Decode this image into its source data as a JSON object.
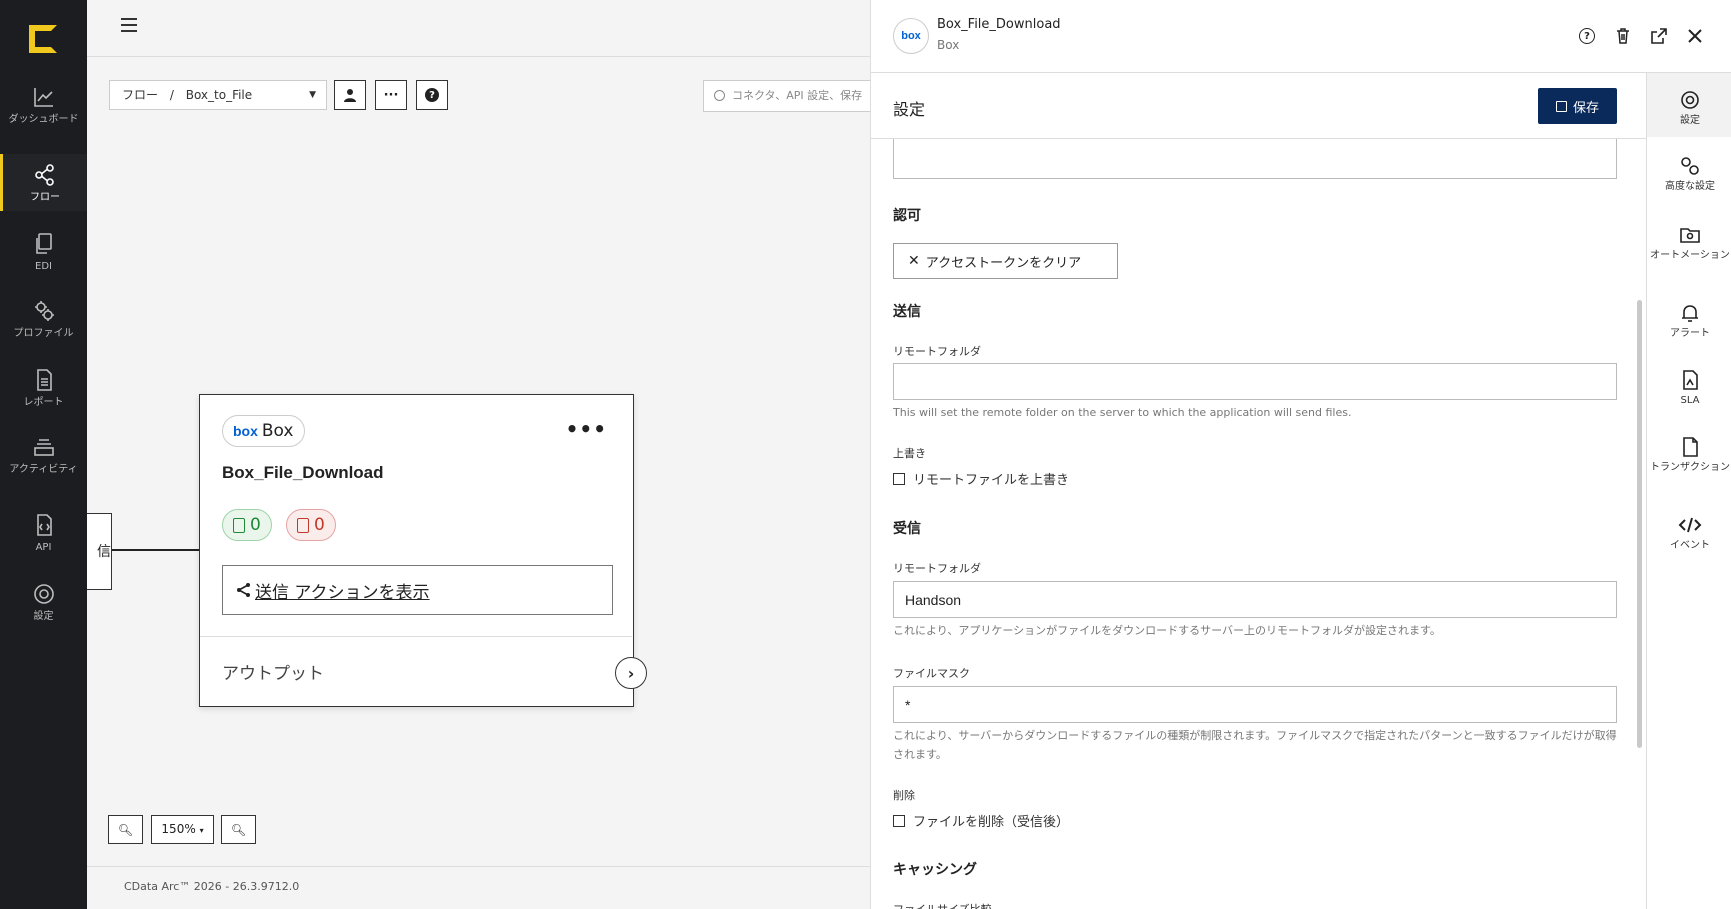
{
  "nav": {
    "items": [
      {
        "label": "ダッシュボード",
        "icon": "chart-line-icon"
      },
      {
        "label": "フロー",
        "icon": "share-nodes-icon"
      },
      {
        "label": "EDI",
        "icon": "documents-icon"
      },
      {
        "label": "プロファイル",
        "icon": "gears-icon"
      },
      {
        "label": "レポート",
        "icon": "report-icon"
      },
      {
        "label": "アクティビティ",
        "icon": "layers-icon"
      },
      {
        "label": "API",
        "icon": "api-file-icon"
      },
      {
        "label": "設定",
        "icon": "gear-icon"
      }
    ],
    "accent": "#f0c81e"
  },
  "toolbar": {
    "breadcrumb_root": "フロー",
    "breadcrumb_sep": "/",
    "breadcrumb_current": "Box_to_File",
    "search_placeholder": "コネクタ、API 設定、保存"
  },
  "left_node": {
    "text": "信"
  },
  "card": {
    "pill_logo": "box",
    "pill_label": "Box",
    "title": "Box_File_Download",
    "success_count": "0",
    "error_count": "0",
    "action_label": "送信 アクションを表示",
    "output_label": "アウトプット"
  },
  "zoom": {
    "level": "150%"
  },
  "footer": {
    "text": "CData Arc™ 2026 - 26.3.9712.0"
  },
  "panel": {
    "avatar": "box",
    "title": "Box_File_Download",
    "subtitle": "Box",
    "settings_title": "設定",
    "save_label": "保存",
    "save_color": "#0a2a5c"
  },
  "form": {
    "auth_section": "認可",
    "clear_token": "アクセストークンをクリア",
    "send_section": "送信",
    "send_remote_label": "リモートフォルダ",
    "send_remote_value": "",
    "send_remote_help": "This will set the remote folder on the server to which the application will send files.",
    "overwrite_label": "上書き",
    "overwrite_check": "リモートファイルを上書き",
    "receive_section": "受信",
    "recv_remote_label": "リモートフォルダ",
    "recv_remote_value": "Handson",
    "recv_remote_help": "これにより、アプリケーションがファイルをダウンロードするサーバー上のリモートフォルダが設定されます。",
    "mask_label": "ファイルマスク",
    "mask_value": "*",
    "mask_help": "これにより、サーバーからダウンロードするファイルの種類が制限されます。ファイルマスクで指定されたパターンと一致するファイルだけが取得されます。",
    "delete_label": "削除",
    "delete_check": "ファイルを削除（受信後）",
    "caching_section": "キャッシング",
    "size_compare_label": "ファイルサイズ比較"
  },
  "rail": [
    {
      "label": "設定",
      "icon": "gear-icon"
    },
    {
      "label": "高度な設定",
      "icon": "gears-icon"
    },
    {
      "label": "オートメーション",
      "icon": "folder-gear-icon"
    },
    {
      "label": "アラート",
      "icon": "bell-icon"
    },
    {
      "label": "SLA",
      "icon": "sla-file-icon"
    },
    {
      "label": "トランザクション",
      "icon": "file-icon"
    },
    {
      "label": "イベント",
      "icon": "code-icon"
    }
  ]
}
